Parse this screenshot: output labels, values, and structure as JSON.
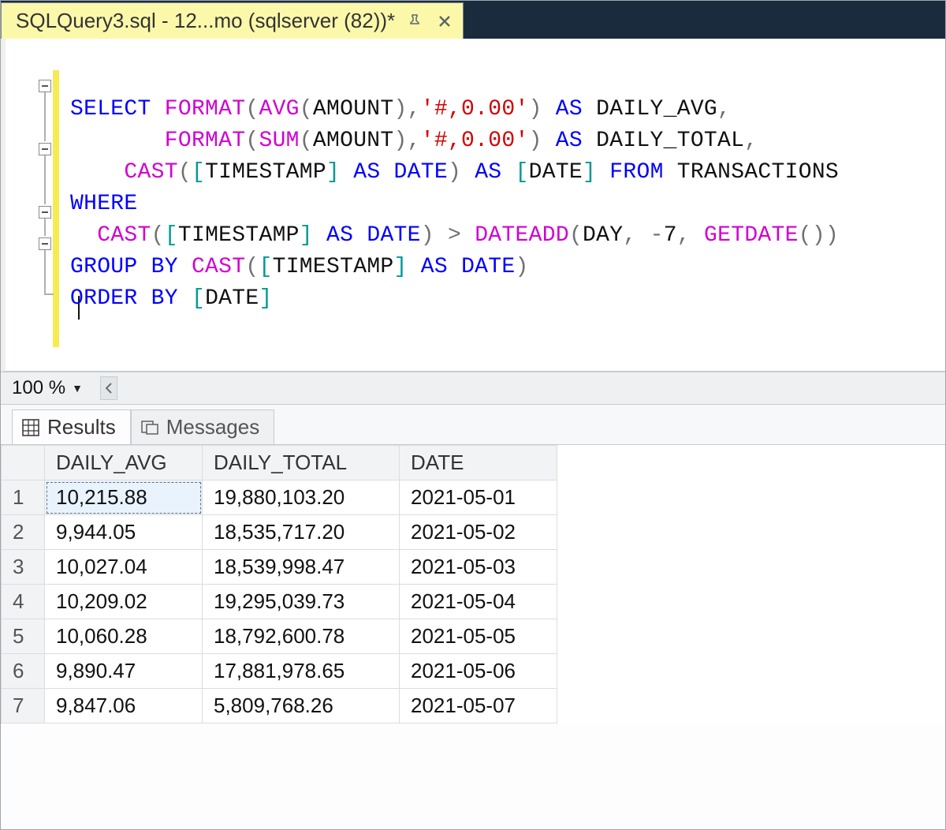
{
  "tab": {
    "title": "SQLQuery3.sql - 12...mo (sqlserver (82))*"
  },
  "code": {
    "tokens": [
      [
        {
          "t": "kw",
          "v": "SELECT"
        },
        {
          "t": "sp",
          "v": " "
        },
        {
          "t": "fn",
          "v": "FORMAT"
        },
        {
          "t": "op",
          "v": "("
        },
        {
          "t": "fn",
          "v": "AVG"
        },
        {
          "t": "op",
          "v": "("
        },
        {
          "t": "id",
          "v": "AMOUNT"
        },
        {
          "t": "op",
          "v": ")"
        },
        {
          "t": "op",
          "v": ","
        },
        {
          "t": "str",
          "v": "'#,0.00'"
        },
        {
          "t": "op",
          "v": ")"
        },
        {
          "t": "sp",
          "v": " "
        },
        {
          "t": "kw",
          "v": "AS"
        },
        {
          "t": "sp",
          "v": " "
        },
        {
          "t": "id",
          "v": "DAILY_AVG"
        },
        {
          "t": "op",
          "v": ","
        }
      ],
      [
        {
          "t": "sp",
          "v": "       "
        },
        {
          "t": "fn",
          "v": "FORMAT"
        },
        {
          "t": "op",
          "v": "("
        },
        {
          "t": "fn",
          "v": "SUM"
        },
        {
          "t": "op",
          "v": "("
        },
        {
          "t": "id",
          "v": "AMOUNT"
        },
        {
          "t": "op",
          "v": ")"
        },
        {
          "t": "op",
          "v": ","
        },
        {
          "t": "str",
          "v": "'#,0.00'"
        },
        {
          "t": "op",
          "v": ")"
        },
        {
          "t": "sp",
          "v": " "
        },
        {
          "t": "kw",
          "v": "AS"
        },
        {
          "t": "sp",
          "v": " "
        },
        {
          "t": "id",
          "v": "DAILY_TOTAL"
        },
        {
          "t": "op",
          "v": ","
        }
      ],
      [
        {
          "t": "sp",
          "v": "    "
        },
        {
          "t": "fn",
          "v": "CAST"
        },
        {
          "t": "op",
          "v": "("
        },
        {
          "t": "tealbr",
          "v": "["
        },
        {
          "t": "id",
          "v": "TIMESTAMP"
        },
        {
          "t": "tealbr",
          "v": "]"
        },
        {
          "t": "sp",
          "v": " "
        },
        {
          "t": "kw",
          "v": "AS"
        },
        {
          "t": "sp",
          "v": " "
        },
        {
          "t": "kw",
          "v": "DATE"
        },
        {
          "t": "op",
          "v": ")"
        },
        {
          "t": "sp",
          "v": " "
        },
        {
          "t": "kw",
          "v": "AS"
        },
        {
          "t": "sp",
          "v": " "
        },
        {
          "t": "tealbr",
          "v": "["
        },
        {
          "t": "id",
          "v": "DATE"
        },
        {
          "t": "tealbr",
          "v": "]"
        },
        {
          "t": "sp",
          "v": " "
        },
        {
          "t": "kw",
          "v": "FROM"
        },
        {
          "t": "sp",
          "v": " "
        },
        {
          "t": "id",
          "v": "TRANSACTIONS"
        }
      ],
      [
        {
          "t": "kw",
          "v": "WHERE"
        }
      ],
      [
        {
          "t": "sp",
          "v": "  "
        },
        {
          "t": "fn",
          "v": "CAST"
        },
        {
          "t": "op",
          "v": "("
        },
        {
          "t": "tealbr",
          "v": "["
        },
        {
          "t": "id",
          "v": "TIMESTAMP"
        },
        {
          "t": "tealbr",
          "v": "]"
        },
        {
          "t": "sp",
          "v": " "
        },
        {
          "t": "kw",
          "v": "AS"
        },
        {
          "t": "sp",
          "v": " "
        },
        {
          "t": "kw",
          "v": "DATE"
        },
        {
          "t": "op",
          "v": ")"
        },
        {
          "t": "sp",
          "v": " "
        },
        {
          "t": "op",
          "v": ">"
        },
        {
          "t": "sp",
          "v": " "
        },
        {
          "t": "fn",
          "v": "DATEADD"
        },
        {
          "t": "op",
          "v": "("
        },
        {
          "t": "id",
          "v": "DAY"
        },
        {
          "t": "op",
          "v": ","
        },
        {
          "t": "sp",
          "v": " "
        },
        {
          "t": "op",
          "v": "-"
        },
        {
          "t": "num",
          "v": "7"
        },
        {
          "t": "op",
          "v": ","
        },
        {
          "t": "sp",
          "v": " "
        },
        {
          "t": "fn",
          "v": "GETDATE"
        },
        {
          "t": "op",
          "v": "()"
        },
        {
          "t": "op",
          "v": ")"
        }
      ],
      [
        {
          "t": "kw",
          "v": "GROUP"
        },
        {
          "t": "sp",
          "v": " "
        },
        {
          "t": "kw",
          "v": "BY"
        },
        {
          "t": "sp",
          "v": " "
        },
        {
          "t": "fn",
          "v": "CAST"
        },
        {
          "t": "op",
          "v": "("
        },
        {
          "t": "tealbr",
          "v": "["
        },
        {
          "t": "id",
          "v": "TIMESTAMP"
        },
        {
          "t": "tealbr",
          "v": "]"
        },
        {
          "t": "sp",
          "v": " "
        },
        {
          "t": "kw",
          "v": "AS"
        },
        {
          "t": "sp",
          "v": " "
        },
        {
          "t": "kw",
          "v": "DATE"
        },
        {
          "t": "op",
          "v": ")"
        }
      ],
      [
        {
          "t": "kw",
          "v": "ORDER"
        },
        {
          "t": "sp",
          "v": " "
        },
        {
          "t": "kw",
          "v": "BY"
        },
        {
          "t": "sp",
          "v": " "
        },
        {
          "t": "tealbr",
          "v": "["
        },
        {
          "t": "id",
          "v": "DATE"
        },
        {
          "t": "tealbr",
          "v": "]"
        }
      ]
    ]
  },
  "zoom": {
    "value": "100 %"
  },
  "resultsTabs": {
    "results": "Results",
    "messages": "Messages"
  },
  "grid": {
    "columns": [
      "DAILY_AVG",
      "DAILY_TOTAL",
      "DATE"
    ],
    "rows": [
      {
        "n": "1",
        "avg": "10,215.88",
        "total": "19,880,103.20",
        "date": "2021-05-01"
      },
      {
        "n": "2",
        "avg": "9,944.05",
        "total": "18,535,717.20",
        "date": "2021-05-02"
      },
      {
        "n": "3",
        "avg": "10,027.04",
        "total": "18,539,998.47",
        "date": "2021-05-03"
      },
      {
        "n": "4",
        "avg": "10,209.02",
        "total": "19,295,039.73",
        "date": "2021-05-04"
      },
      {
        "n": "5",
        "avg": "10,060.28",
        "total": "18,792,600.78",
        "date": "2021-05-05"
      },
      {
        "n": "6",
        "avg": "9,890.47",
        "total": "17,881,978.65",
        "date": "2021-05-06"
      },
      {
        "n": "7",
        "avg": "9,847.06",
        "total": "5,809,768.26",
        "date": "2021-05-07"
      }
    ]
  }
}
